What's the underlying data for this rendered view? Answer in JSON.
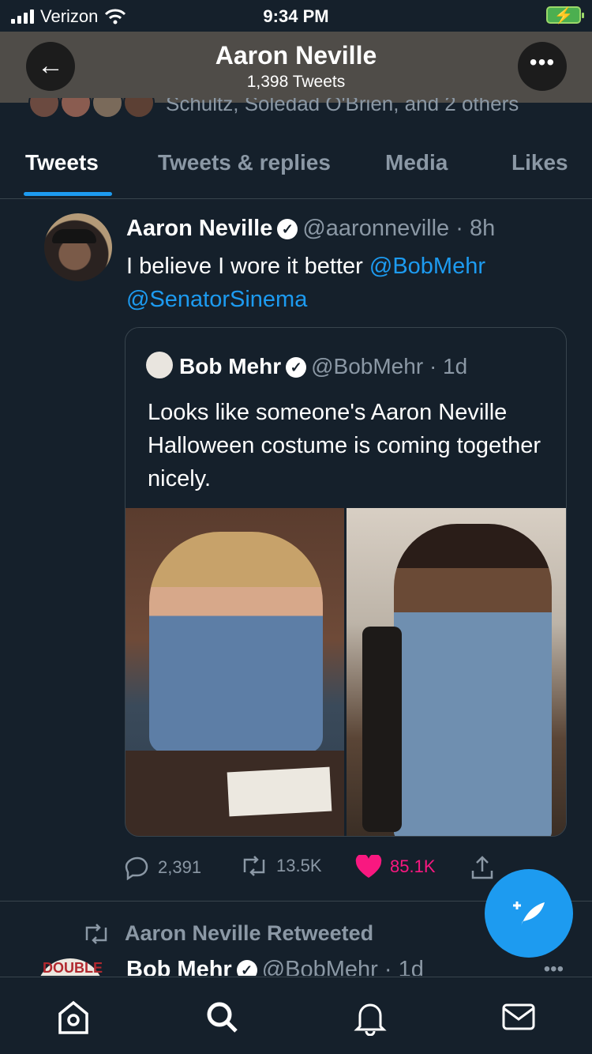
{
  "status_bar": {
    "carrier": "Verizon",
    "time": "9:34 PM"
  },
  "header": {
    "title": "Aaron Neville",
    "tweet_count": "1,398 Tweets",
    "back_icon": "arrow-left-icon",
    "more_icon": "more-horizontal-icon"
  },
  "followers_line": "Schultz, Soledad O'Brien, and 2 others",
  "tabs": [
    {
      "label": "Tweets",
      "active": true
    },
    {
      "label": "Tweets & replies",
      "active": false
    },
    {
      "label": "Media",
      "active": false
    },
    {
      "label": "Likes",
      "active": false
    }
  ],
  "tweet": {
    "name": "Aaron Neville",
    "handle": "@aaronneville",
    "time": "· 8h",
    "text": "I believe I wore it better",
    "mentions": [
      "@BobMehr",
      "@SenatorSinema"
    ],
    "quote": {
      "name": "Bob Mehr",
      "handle": "@BobMehr",
      "time": "· 1d",
      "text": "Looks like someone's Aaron Neville Halloween costume is coming together nicely."
    },
    "actions": {
      "replies": "2,391",
      "retweets": "13.5K",
      "likes": "85.1K"
    }
  },
  "retweeted_label": "Aaron Neville Retweeted",
  "next_tweet": {
    "name": "Bob Mehr",
    "handle": "@BobMehr · 1d",
    "avatar_text": "DOUBLE"
  },
  "colors": {
    "background": "#15202b",
    "accent": "#1d9bf0",
    "like": "#f91880",
    "muted": "#8b98a5"
  },
  "bottom_nav": [
    "home-icon",
    "search-icon",
    "notifications-icon",
    "messages-icon"
  ]
}
